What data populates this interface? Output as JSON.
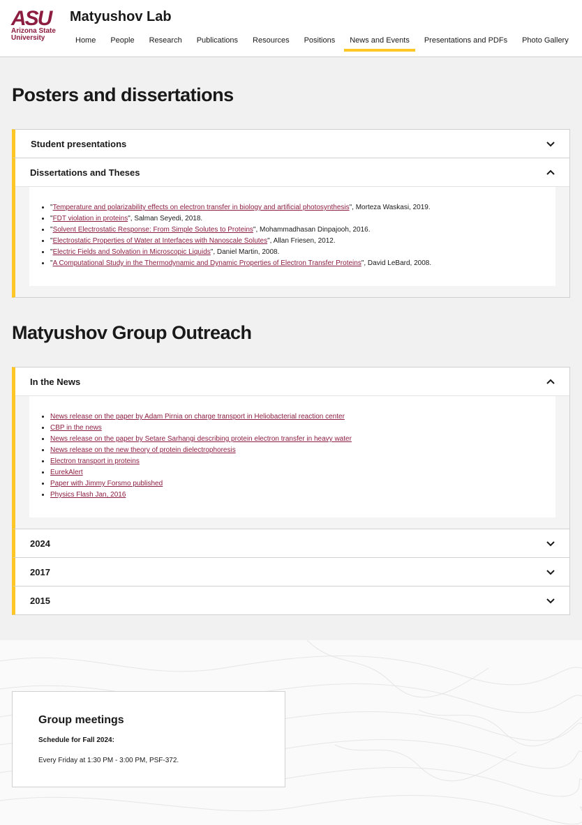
{
  "header": {
    "logo_mark": "ASU",
    "logo_text": "Arizona State University",
    "site_title": "Matyushov Lab",
    "nav": [
      {
        "label": "Home"
      },
      {
        "label": "People"
      },
      {
        "label": "Research"
      },
      {
        "label": "Publications"
      },
      {
        "label": "Resources"
      },
      {
        "label": "Positions"
      },
      {
        "label": "News and Events",
        "active": true
      },
      {
        "label": "Presentations and PDFs"
      },
      {
        "label": "Photo Gallery"
      }
    ]
  },
  "section1": {
    "title": "Posters and dissertations",
    "items": [
      {
        "label": "Student presentations",
        "expanded": false
      },
      {
        "label": "Dissertations and Theses",
        "expanded": true
      }
    ],
    "dissertations": [
      {
        "title": "Temperature and polarizability effects on electron transfer in biology and artificial photosynthesis",
        "rest": "\", Morteza Waskasi, 2019."
      },
      {
        "title": "FDT violation in proteins",
        "rest": "\", Salman Seyedi, 2018."
      },
      {
        "title": "Solvent Electrostatic Response: From Simple Solutes to Proteins",
        "rest": "\", Mohammadhasan Dinpajooh, 2016."
      },
      {
        "title": "Electrostatic Properties of Water at Interfaces with Nanoscale Solutes",
        "rest": "\", Allan Friesen, 2012."
      },
      {
        "title": "Electric Fields and Solvation in Microscopic Liquids",
        "rest": "\", Daniel Martin, 2008."
      },
      {
        "title": "A Computational Study in the Thermodynamic and Dynamic Properties of Electron Transfer Proteins",
        "rest": "\", David LeBard, 2008."
      }
    ]
  },
  "section2": {
    "title": "Matyushov Group Outreach",
    "items": [
      {
        "label": "In the News",
        "expanded": true
      },
      {
        "label": "2024",
        "expanded": false
      },
      {
        "label": "2017",
        "expanded": false
      },
      {
        "label": "2015",
        "expanded": false
      }
    ],
    "news": [
      "News release on the paper by Adam Pirnia on charge transport in Heliobacterial reaction center ",
      "CBP in the news",
      "News release on the paper by Setare Sarhangi describing protein electron transfer in heavy water",
      "News release on the new theory of protein dielectrophoresis",
      "Electron transport in proteins",
      "EurekAlert",
      "Paper with Jimmy Forsmo published",
      "Physics Flash Jan, 2016"
    ]
  },
  "footer": {
    "card_title": "Group meetings",
    "card_sub": "Schedule for Fall 2024:",
    "card_text": "Every Friday at 1:30 PM - 3:00 PM, PSF-372."
  },
  "colors": {
    "maroon": "#8c1d40",
    "gold": "#ffc627"
  }
}
